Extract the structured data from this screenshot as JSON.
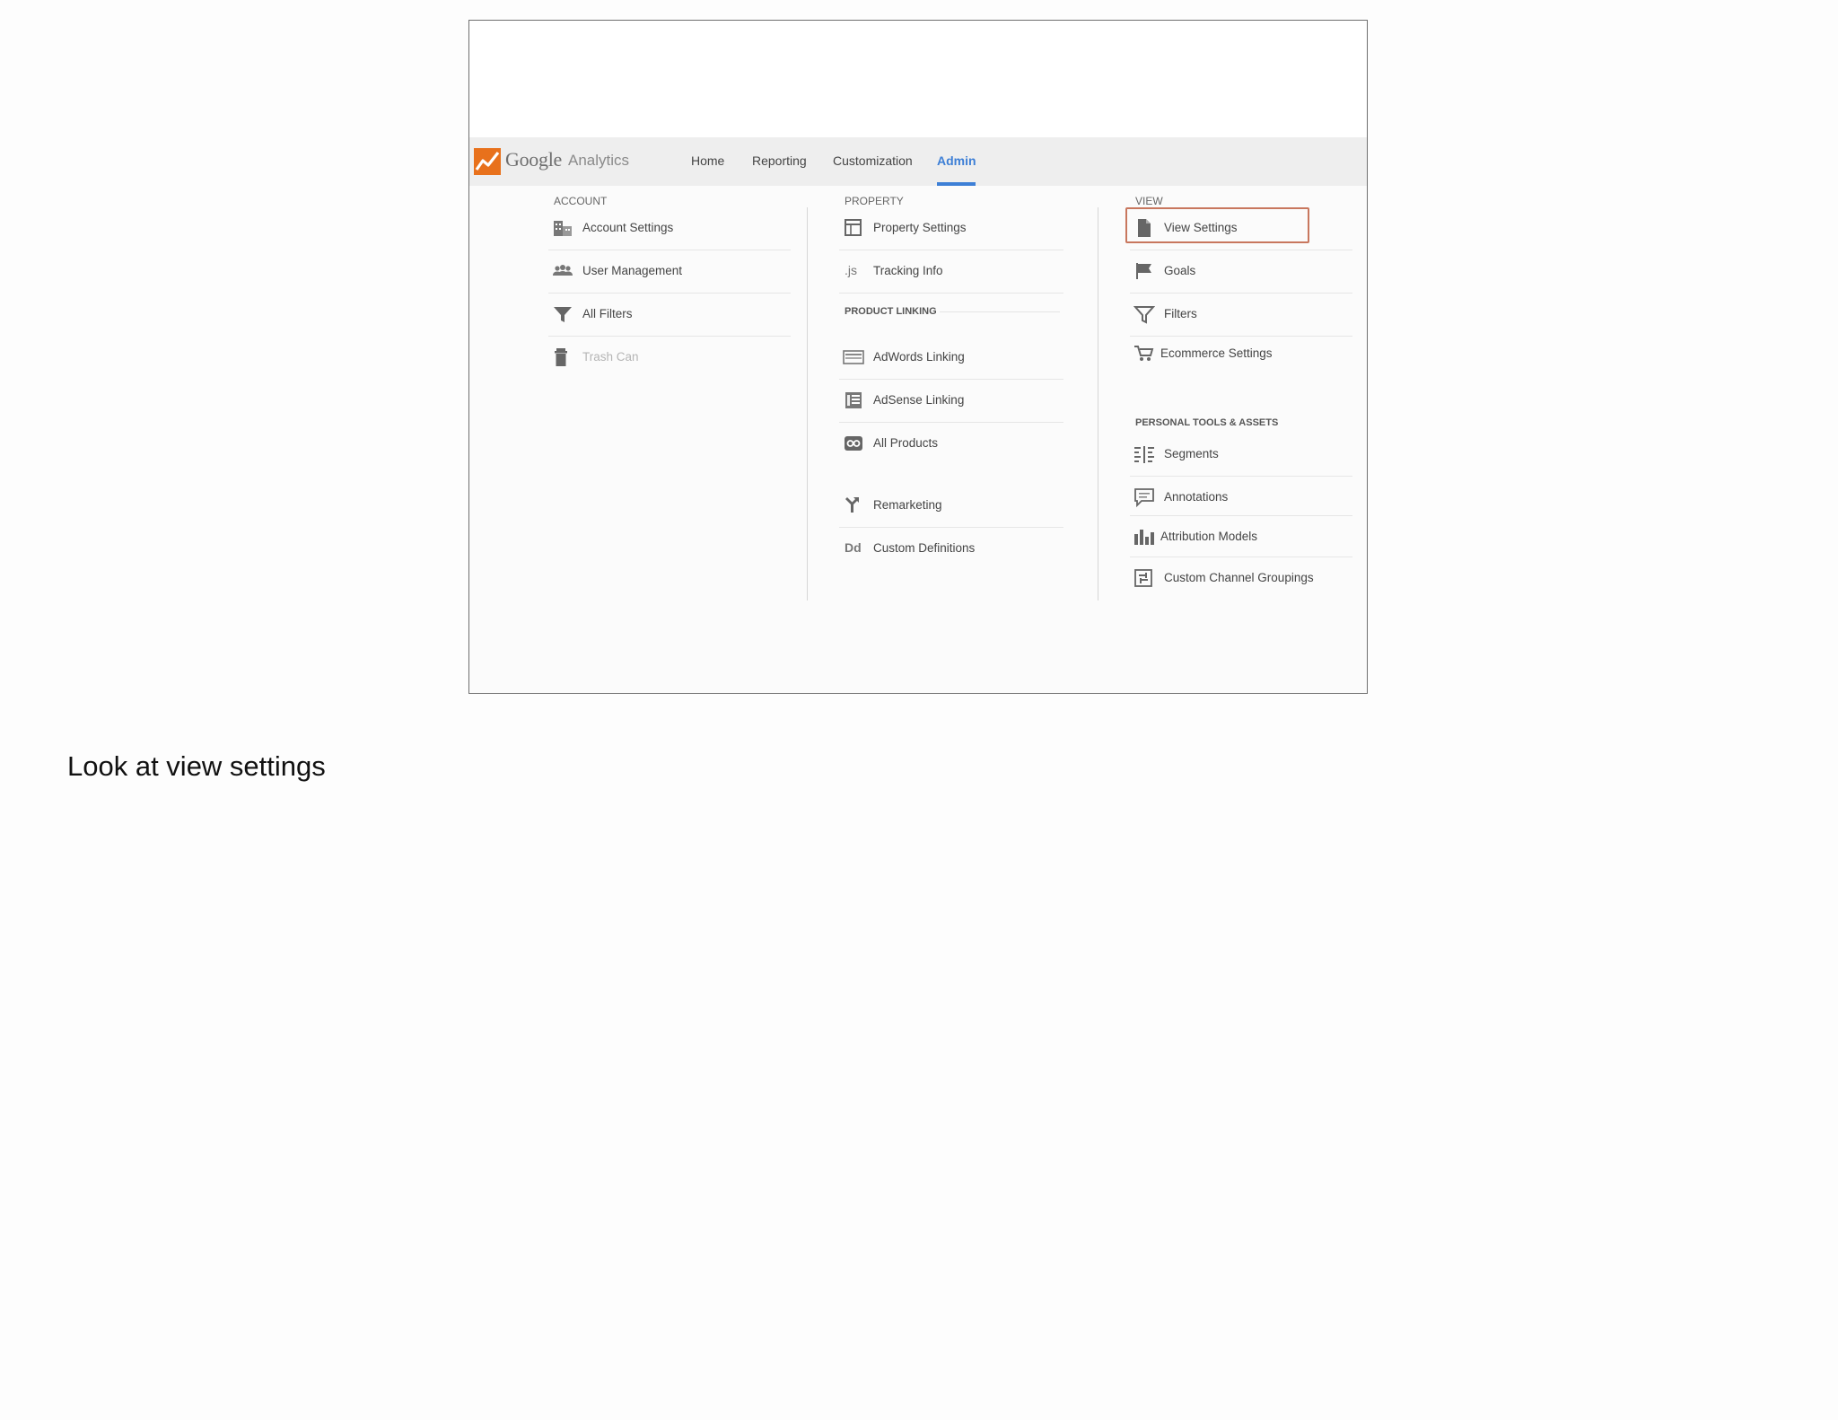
{
  "app": {
    "brand_main": "Google",
    "brand_sub": "Analytics",
    "brand_color": "#e8711c",
    "accent_color": "#3d7fd6"
  },
  "nav": {
    "home": "Home",
    "reporting": "Reporting",
    "customization": "Customization",
    "admin": "Admin",
    "active": "Admin"
  },
  "account": {
    "label": "ACCOUNT",
    "items": [
      {
        "label": "Account Settings",
        "icon": "building-icon"
      },
      {
        "label": "User Management",
        "icon": "users-icon"
      },
      {
        "label": "All Filters",
        "icon": "filter-icon"
      },
      {
        "label": "Trash Can",
        "icon": "trash-icon",
        "disabled": true
      }
    ]
  },
  "property": {
    "label": "PROPERTY",
    "items": [
      {
        "label": "Property Settings",
        "icon": "window-icon"
      },
      {
        "label": "Tracking Info",
        "icon": "js-icon"
      }
    ],
    "product_linking_label": "PRODUCT LINKING",
    "linking_items": [
      {
        "label": "AdWords Linking",
        "icon": "adwords-icon"
      },
      {
        "label": "AdSense Linking",
        "icon": "adsense-icon"
      },
      {
        "label": "All Products",
        "icon": "link-icon"
      }
    ],
    "more_items": [
      {
        "label": "Remarketing",
        "icon": "remarketing-icon"
      },
      {
        "label": "Custom Definitions",
        "icon": "dd-icon"
      }
    ]
  },
  "view": {
    "label": "VIEW",
    "items": [
      {
        "label": "View Settings",
        "icon": "document-icon",
        "highlighted": true
      },
      {
        "label": "Goals",
        "icon": "flag-icon"
      },
      {
        "label": "Filters",
        "icon": "filter-icon"
      },
      {
        "label": "Ecommerce Settings",
        "icon": "cart-icon"
      }
    ],
    "personal_label": "PERSONAL TOOLS & ASSETS",
    "personal_items": [
      {
        "label": "Segments",
        "icon": "segments-icon"
      },
      {
        "label": "Annotations",
        "icon": "comment-icon"
      },
      {
        "label": "Attribution Models",
        "icon": "bar-chart-icon"
      },
      {
        "label": "Custom Channel Groupings",
        "icon": "channel-icon"
      }
    ]
  },
  "icon_glyphs": {
    "js": ".js",
    "dd": "Dd"
  },
  "caption": "Look at view settings"
}
